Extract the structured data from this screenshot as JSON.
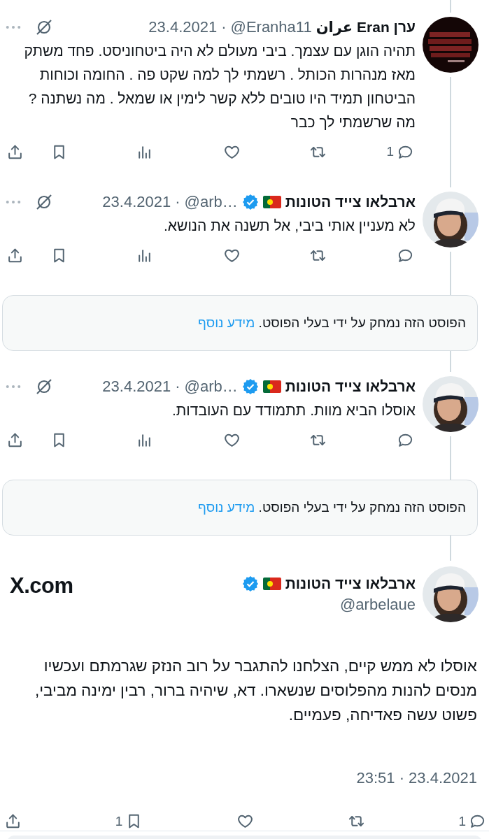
{
  "thread": [
    {
      "kind": "reply",
      "dark_avatar": true,
      "name": "ערן Eran عران",
      "flag": false,
      "verified": false,
      "handle": "@Eranha11",
      "separator": "·",
      "date": "23.4.2021",
      "text": "תהיה הוגן עם עצמך.  ביבי מעולם לא היה ביטחוניסט. פחד משתק מאז מנהרות הכותל . רשמתי לך למה שקט פה . החומה וכוחות הביטחון תמיד היו טובים ללא קשר לימין או שמאל . מה נשתנה ? מה שרשמתי לך כבר",
      "actions": [
        {
          "kind": "reply",
          "count": "1"
        },
        {
          "kind": "repost"
        },
        {
          "kind": "like"
        },
        {
          "kind": "views"
        },
        {
          "kind": "bookmark"
        },
        {
          "kind": "share"
        }
      ]
    },
    {
      "kind": "reply",
      "dark_avatar": false,
      "name": "ארבלאו צייד הטונות",
      "flag": true,
      "verified": true,
      "handle": "@arb…",
      "separator": "·",
      "date": "23.4.2021",
      "text": "לא מעניין אותי ביבי, אל תשנה את הנושא.",
      "actions": [
        {
          "kind": "reply"
        },
        {
          "kind": "repost"
        },
        {
          "kind": "like"
        },
        {
          "kind": "views"
        },
        {
          "kind": "bookmark"
        },
        {
          "kind": "share"
        }
      ]
    },
    {
      "kind": "deleted",
      "text": "הפוסט הזה נמחק על ידי בעלי הפוסט.",
      "link": "מידע נוסף"
    },
    {
      "kind": "reply",
      "dark_avatar": false,
      "name": "ארבלאו צייד הטונות",
      "flag": true,
      "verified": true,
      "handle": "@arb…",
      "separator": "·",
      "date": "23.4.2021",
      "text": "אוסלו הביא מוות. תתמודד עם העובדות.",
      "actions": [
        {
          "kind": "reply"
        },
        {
          "kind": "repost"
        },
        {
          "kind": "like"
        },
        {
          "kind": "views"
        },
        {
          "kind": "bookmark"
        },
        {
          "kind": "share"
        }
      ]
    },
    {
      "kind": "deleted",
      "text": "הפוסט הזה נמחק על ידי בעלי הפוסט.",
      "link": "מידע נוסף"
    }
  ],
  "main_post": {
    "dark_avatar": false,
    "name": "ארבלאו צייד הטונות",
    "flag": true,
    "verified": true,
    "handle": "@arbelaue",
    "site": "X.com",
    "text": "אוסלו לא ממש קיים, הצלחנו להתגבר על רוב הנזק שגרמתם ועכשיו מנסים להנות מהפלוסים שנשארו. דא, שיהיה ברור, רבין ימינה מביבי, פשוט עשה פאדיחה, פעמיים.",
    "timestamp": "23:51 · 23.4.2021",
    "actions": [
      {
        "kind": "reply",
        "count": "1"
      },
      {
        "kind": "repost"
      },
      {
        "kind": "like"
      },
      {
        "kind": "bookmark",
        "count": "1"
      },
      {
        "kind": "share"
      }
    ]
  }
}
